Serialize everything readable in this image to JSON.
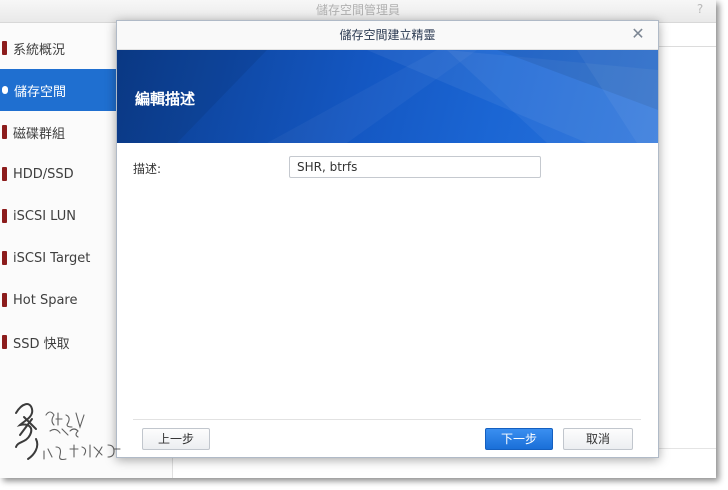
{
  "app": {
    "title": "儲存空間管理員"
  },
  "sidebar": {
    "items": [
      {
        "label": "系統概況",
        "active": false
      },
      {
        "label": "儲存空間",
        "active": true
      },
      {
        "label": "磁碟群組",
        "active": false
      },
      {
        "label": "HDD/SSD",
        "active": false
      },
      {
        "label": "iSCSI LUN",
        "active": false
      },
      {
        "label": "iSCSI Target",
        "active": false
      },
      {
        "label": "Hot Spare",
        "active": false
      },
      {
        "label": "SSD 快取",
        "active": false
      }
    ]
  },
  "dialog": {
    "title": "儲存空間建立精靈",
    "banner_title": "編輯描述",
    "field_label": "描述:",
    "field_value": "SHR, btrfs",
    "prev_label": "上一步",
    "next_label": "下一步",
    "cancel_label": "取消"
  },
  "icons": {
    "close": "close-icon",
    "help": "help-icon",
    "sidebar_marker": "storage-icon"
  },
  "colors": {
    "accent": "#1f6fd0",
    "banner": "#1457c2",
    "primary_button": "#1a6fd8",
    "sidebar_icon": "#8c1c1c"
  }
}
